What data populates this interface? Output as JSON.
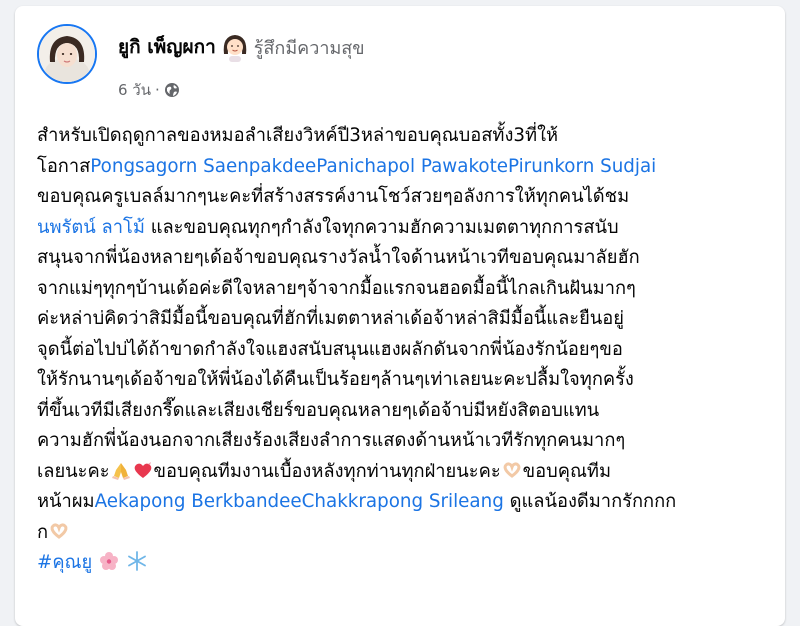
{
  "post": {
    "author": "ยูกิ เพ็ญผกา",
    "feeling": "รู้สึกมีความสุข",
    "timestamp": "6 วัน",
    "separator": "·",
    "privacy_icon": "globe-icon"
  },
  "body": {
    "l1": "สำหรับเปิดฤดูกาลของหมอลำเสียงวิหค์ปี3หล่าขอบคุณบอสทั้ง3ที่ให้",
    "l2_prefix": "โอกาส",
    "tag_pongsagorn": "Pongsagorn Saenpakdee",
    "tag_panichapol": "Panichapol Pawakote",
    "tag_pirunkorn": "Pirunkorn Sudjai",
    "l3": "ขอบคุณครูเบลล์มากๆนะคะที่สร้างสรรค์งานโชว์สวยๆอลังการให้ทุกคนได้ชม",
    "tag_napat": "นพรัตน์ ลาโม้",
    "l4_suffix": " และขอบคุณทุกๆกำลังใจทุกความฮักความเมตตาทุกการสนับ",
    "l5": "สนุนจากพี่น้องหลายๆเด้อจ้าขอบคุณรางวัลน้ำใจด้านหน้าเวทีขอบคุณมาลัยฮัก",
    "l6": "จากแม่ๆทุกๆบ้านเด้อค่ะดีใจหลายๆจ้าจากมื้อแรกจนฮอดมื้อนี้ไกลเกินฝันมากๆ",
    "l7": "ค่ะหล่าบ่คิดว่าสิมีมื้อนี้ขอบคุณที่ฮักที่เมตตาหล่าเด้อจ้าหล่าสิมีมื้อนี้และยืนอยู่",
    "l8": "จุดนี้ต่อไปบ่ได้ถ้าขาดกำลังใจแฮงสนับสนุนแฮงผลักดันจากพี่น้องรักน้อยๆขอ",
    "l9": "ให้รักนานๆเด้อจ้าขอให้พี่น้องได้คืนเป็นร้อยๆล้านๆเท่าเลยนะคะปลื้มใจทุกครั้ง",
    "l10": "ที่ขึ้นเวทีมีเสียงกรี๊ดและเสียงเชียร์ขอบคุณหลายๆเด้อจ้าบ่มีหยังสิตอบแทน",
    "l11": "ความฮักพี่น้องนอกจากเสียงร้องเสียงลำการแสดงด้านหน้าเวทีรักทุกคนมากๆ",
    "l12_a": "เลยนะคะ",
    "l12_b": "ขอบคุณทีมงานเบื้องหลังทุกท่านทุกฝ่ายนะคะ",
    "l12_c": "ขอบคุณทีม",
    "l13_prefix": "หน้าผม",
    "tag_aekapong": "Aekapong Berkbandee",
    "tag_chakkrapong": "Chakkrapong Srileang",
    "l13_suffix": " ดูแลน้องดีมากรักกกก",
    "l14": "ก",
    "hashtag": "#คุณยู"
  },
  "emoji": {
    "feeling": "smiling-face-emoji",
    "e1": "folded-hands-emoji",
    "e2": "heart-emoji",
    "e3": "heart-hands-emoji",
    "e4": "heart-hands-emoji",
    "e5": "cherry-blossom-emoji",
    "e6": "snowflake-emoji"
  },
  "colors": {
    "link": "#1b74e4",
    "text": "#050505",
    "secondary": "#65676b"
  }
}
